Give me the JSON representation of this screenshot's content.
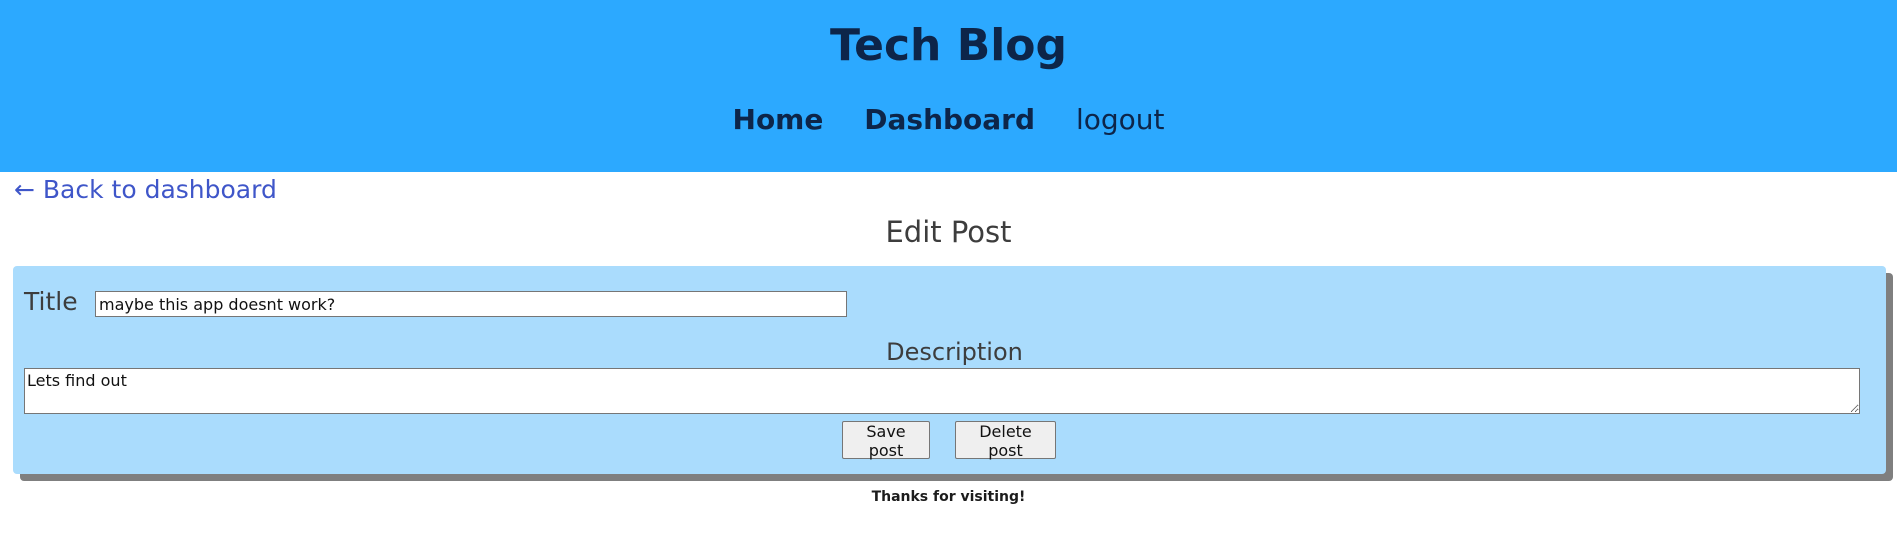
{
  "header": {
    "site_title": "Tech Blog",
    "nav": {
      "home": "Home",
      "dashboard": "Dashboard",
      "logout": "logout"
    },
    "bg_color": "#2ca9ff"
  },
  "back_link": "← Back to dashboard",
  "page_title": "Edit Post",
  "form": {
    "title_label": "Title",
    "title_value": "maybe this app doesnt work?",
    "description_label": "Description",
    "description_value": "Lets find out",
    "save_label": "Save post",
    "delete_label": "Delete post",
    "card_color": "#aadcfd"
  },
  "footer": {
    "text": "Thanks for visiting!"
  }
}
